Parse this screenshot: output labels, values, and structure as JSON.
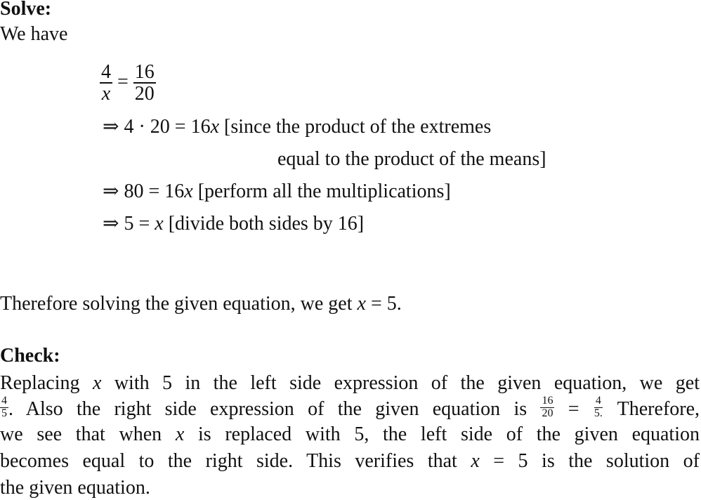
{
  "solve": {
    "heading": "Solve:",
    "intro": "We have",
    "equation": {
      "lhs_num": "4",
      "lhs_den": "x",
      "eq": "=",
      "rhs_num": "16",
      "rhs_den": "20"
    },
    "steps": [
      {
        "arrow": "⇒",
        "math": "4 · 20 = 16",
        "var": "x",
        "note": "[since the product of the extremes"
      },
      {
        "continuation": "equal to the product of the means]"
      },
      {
        "arrow": "⇒",
        "math": "80 = 16",
        "var": "x",
        "note": "[perform all the multiplications]"
      },
      {
        "arrow": "⇒",
        "math": "5 = ",
        "var": "x",
        "note": "[divide both sides by 16]"
      }
    ],
    "conclusion_pre": "Therefore solving the given equation, we get ",
    "conclusion_var": "x",
    "conclusion_post": " = 5."
  },
  "check": {
    "heading": "Check:",
    "line1_a": "Replacing ",
    "line1_var": "x",
    "line1_b": " with 5 in the left side expression of the given equation, we get",
    "line2_frac1_num": "4",
    "line2_frac1_den": "5",
    "line2_a": ". Also the right side expression of the given equation is ",
    "line2_frac2_num": "16",
    "line2_frac2_den": "20",
    "line2_eq": " = ",
    "line2_frac3_num": "4",
    "line2_frac3_den": "5.",
    "line2_b": " Therefore,",
    "line3_a": "we see that when ",
    "line3_var": "x",
    "line3_b": " is replaced with 5, the left side of the given equation",
    "line4": "becomes equal to the right side.  This verifies that ",
    "line4_var": "x",
    "line4_b": " = 5 is the solution of",
    "line5": "the given equation."
  }
}
